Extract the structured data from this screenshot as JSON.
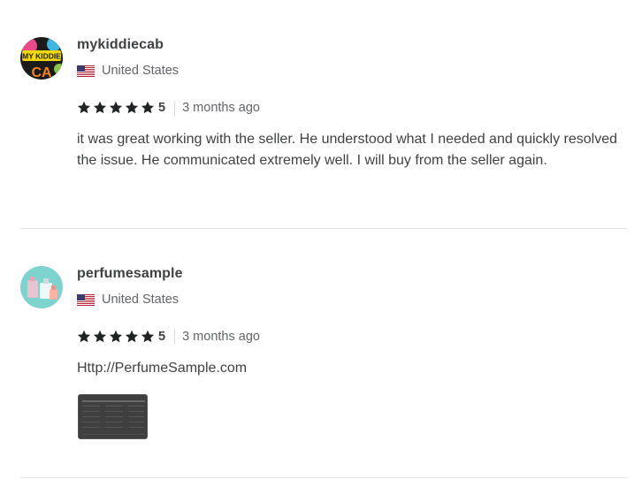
{
  "reviews": [
    {
      "username": "mykiddiecab",
      "avatar_text": "MY KIDDIE",
      "country": "United States",
      "flag_icon": "us-flag-icon",
      "stars": 5,
      "score": "5",
      "time_ago": "3 months ago",
      "text": "it was great working with the seller. He understood what I needed and quickly resolved the issue. He communicated extremely well. I will buy from the seller again."
    },
    {
      "username": "perfumesample",
      "country": "United States",
      "flag_icon": "us-flag-icon",
      "stars": 5,
      "score": "5",
      "time_ago": "3 months ago",
      "text": "Http://PerfumeSample.com",
      "has_attachment": true
    }
  ],
  "colors": {
    "text_dark": "#404145",
    "text_muted": "#62646a",
    "star": "#222325",
    "divider": "#e4e5e7"
  }
}
